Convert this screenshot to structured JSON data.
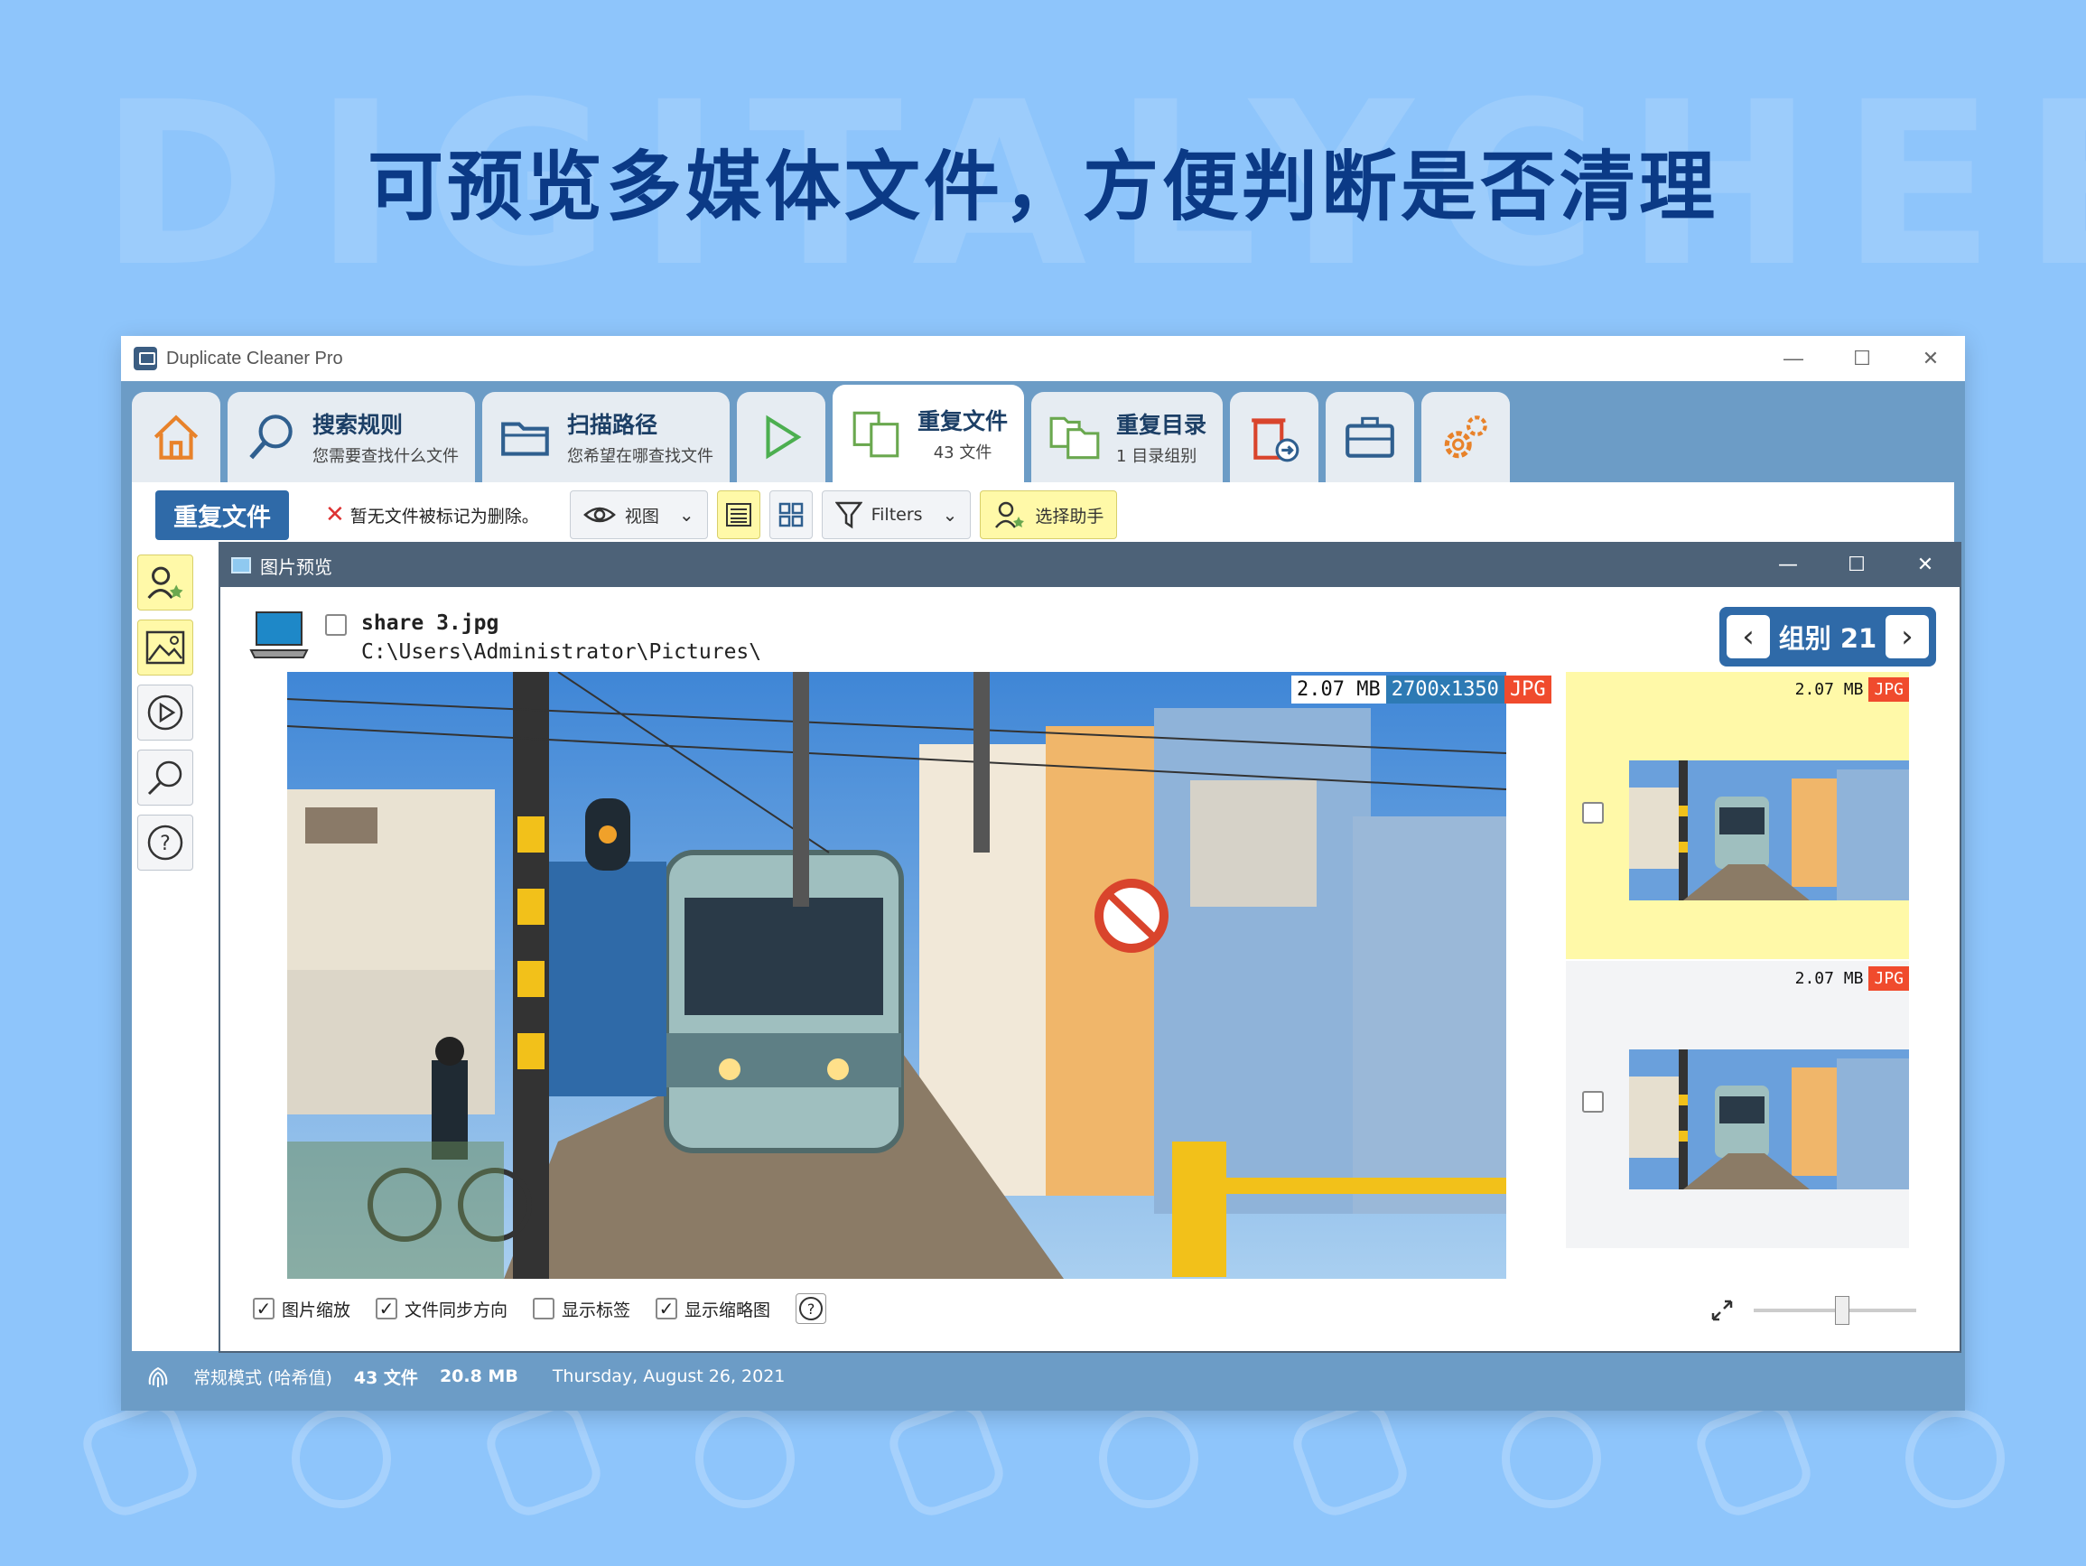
{
  "background": {
    "watermark": "DIGITALYCHEE",
    "headline": "可预览多媒体文件，方便判断是否清理"
  },
  "window": {
    "title": "Duplicate Cleaner Pro",
    "controls": {
      "minimize": "—",
      "maximize": "☐",
      "close": "✕"
    }
  },
  "tabs": [
    {
      "icon": "home-icon"
    },
    {
      "icon": "search-icon",
      "title": "搜索规则",
      "subtitle": "您需要查找什么文件"
    },
    {
      "icon": "folder-icon",
      "title": "扫描路径",
      "subtitle": "您希望在哪查找文件"
    },
    {
      "icon": "play-icon"
    },
    {
      "icon": "duplicate-files-icon",
      "title": "重复文件",
      "subtitle": "43 文件",
      "active": true
    },
    {
      "icon": "duplicate-folders-icon",
      "title": "重复目录",
      "subtitle": "1 目录组别"
    },
    {
      "icon": "trash-move-icon"
    },
    {
      "icon": "toolbox-icon"
    },
    {
      "icon": "settings-icon"
    }
  ],
  "subbar": {
    "section_label": "重复文件",
    "status_text": "暂无文件被标记为删除。",
    "view_label": "视图",
    "filters_label": "Filters",
    "select_assistant_label": "选择助手"
  },
  "preview": {
    "title": "图片预览",
    "file_name": "share 3.jpg",
    "file_path": "C:\\Users\\Administrator\\Pictures\\",
    "group_label": "组别 21",
    "group_prev": "‹",
    "group_next": "›",
    "main_badges": {
      "size": "2.07 MB",
      "dimensions": "2700x1350",
      "type": "JPG"
    },
    "thumbnails": [
      {
        "size": "2.07 MB",
        "type": "JPG",
        "selected_highlight": true,
        "checked": false
      },
      {
        "size": "2.07 MB",
        "type": "JPG",
        "selected_highlight": false,
        "checked": false
      }
    ],
    "options": [
      {
        "label": "图片缩放",
        "checked": true
      },
      {
        "label": "文件同步方向",
        "checked": true
      },
      {
        "label": "显示标签",
        "checked": false
      },
      {
        "label": "显示缩略图",
        "checked": true
      }
    ],
    "help": "?",
    "zoom_level": 0.55
  },
  "statusbar": {
    "mode": "常规模式 (哈希值)",
    "files": "43 文件",
    "size": "20.8 MB",
    "date": "Thursday, August 26, 2021"
  },
  "colors": {
    "background": "#8ec5fb",
    "headline": "#0b3a86",
    "accent": "#2f6aa8",
    "highlight": "#fff9a8",
    "jpg_badge": "#f04b2d",
    "dimension_badge": "#2d7ab4"
  }
}
